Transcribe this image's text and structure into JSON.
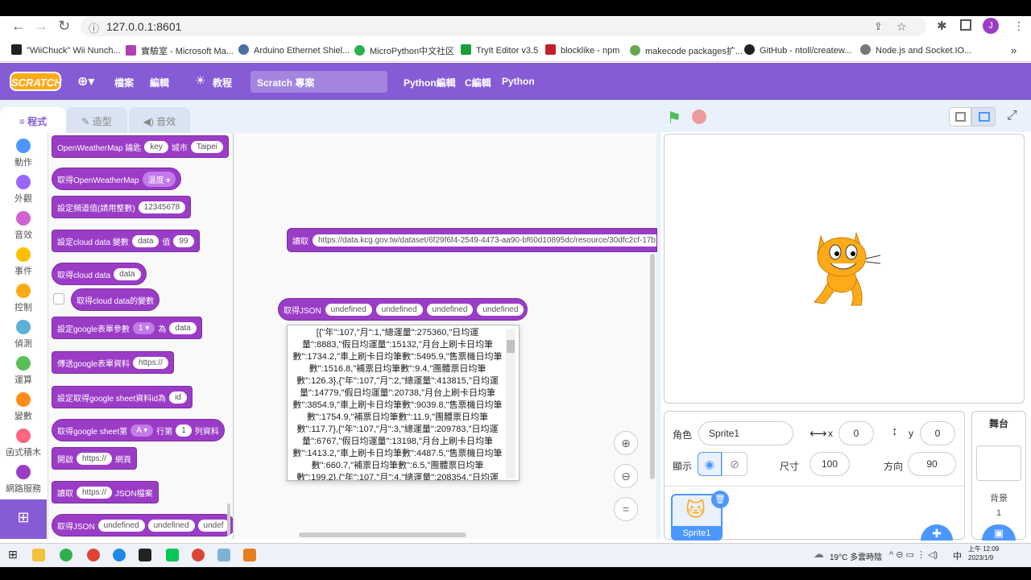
{
  "browser": {
    "url": "127.0.0.1:8601",
    "avatar": "J"
  },
  "bookmarks": [
    {
      "label": "\"WiiChuck\" Wii Nunch...",
      "color": "#222"
    },
    {
      "label": "實驗室 - Microsoft Ma...",
      "color": "#b03fb3"
    },
    {
      "label": "Arduino Ethernet Shiel...",
      "color": "#4a6fa5"
    },
    {
      "label": "MicroPython中文社区",
      "color": "#2bb24c"
    },
    {
      "label": "TryIt Editor v3.5",
      "color": "#1a9e3b"
    },
    {
      "label": "blocklike - npm",
      "color": "#c12127"
    },
    {
      "label": "makecode packages扩...",
      "color": "#6aa84f"
    },
    {
      "label": "GitHub - ntoll/createw...",
      "color": "#222"
    },
    {
      "label": "Node.js and Socket.IO...",
      "color": "#777"
    }
  ],
  "menubar": {
    "logo": "SCRATCH",
    "file": "檔案",
    "edit": "編輯",
    "tutorials": "教程",
    "project_title": "Scratch 專案",
    "python_editor": "Python編輯",
    "c_editor": "C編輯",
    "python": "Python"
  },
  "tabs": {
    "code": "程式",
    "costumes": "造型",
    "sounds": "音效"
  },
  "categories": [
    {
      "label": "動作",
      "color": "#4c97ff"
    },
    {
      "label": "外觀",
      "color": "#9966ff"
    },
    {
      "label": "音效",
      "color": "#cf63cf"
    },
    {
      "label": "事件",
      "color": "#ffbf00"
    },
    {
      "label": "控制",
      "color": "#ffab19"
    },
    {
      "label": "偵測",
      "color": "#5cb1d6"
    },
    {
      "label": "運算",
      "color": "#59c059"
    },
    {
      "label": "變數",
      "color": "#ff8c1a"
    },
    {
      "label": "函式積木",
      "color": "#ff6680"
    },
    {
      "label": "網路服務",
      "color": "#9b3cc7"
    }
  ],
  "palette": {
    "b1": {
      "text": "OpenWeatherMap 鑰匙",
      "p1": "key",
      "t2": "城市",
      "p2": "Taipei"
    },
    "b2": {
      "text": "取得OpenWeatherMap",
      "dd": "溫度"
    },
    "b3": {
      "text": "設定頻道值(請用整數)",
      "p1": "12345678"
    },
    "b4": {
      "text": "設定cloud data 變數",
      "p1": "data",
      "t2": "值",
      "p2": "99"
    },
    "b5": {
      "text": "取得cloud data",
      "p1": "data"
    },
    "b6": {
      "text": "取得cloud data的變數"
    },
    "b7": {
      "text": "設定google表單參數",
      "dd": "1",
      "t2": "為",
      "p2": "data"
    },
    "b8": {
      "text": "傳送google表單資料",
      "p1": "https://"
    },
    "b9": {
      "text": "設定取得google sheet資料id為",
      "p1": "id"
    },
    "b10": {
      "text": "取得google sheet第",
      "dd": "A",
      "t2": "行第",
      "p2": "1",
      "t3": "列資料"
    },
    "b11": {
      "text": "開啟",
      "p1": "https://",
      "t2": "網頁"
    },
    "b12": {
      "text": "讀取",
      "p1": "https://",
      "t2": "JSON檔案"
    },
    "b13": {
      "text": "取得JSON",
      "p1": "undefined",
      "p2": "undefined",
      "p3": "undef"
    }
  },
  "workspace": {
    "read_block": {
      "text": "讀取",
      "url": "https://data.kcg.gov.tw/dataset/6f29f6f4-2549-4473-aa90-bf60d10895dc/resource/30dfc2cf-17b"
    },
    "json_block": {
      "text": "取得JSON",
      "p1": "undefined",
      "p2": "undefined",
      "p3": "undefined",
      "p4": "undefined"
    },
    "popup_text": "[{\"年\":107,\"月\":1,\"總運量\":275360,\"日均運量\":8883,\"假日均運量\":15132,\"月台上刷卡日均筆數\":1734.2,\"車上刷卡日均筆數\":5495.9,\"售票機日均筆數\":1516.8,\"補票日均筆數\":9.4,\"團體票日均筆數\":126.3},{\"年\":107,\"月\":2,\"總運量\":413815,\"日均運量\":14779,\"假日均運量\":20738,\"月台上刷卡日均筆數\":3854.9,\"車上刷卡日均筆數\":9039.8,\"售票機日均筆數\":1754.9,\"補票日均筆數\":11.9,\"團體票日均筆數\":117.7},{\"年\":107,\"月\":3,\"總運量\":209783,\"日均運量\":6767,\"假日均運量\":13198,\"月台上刷卡日均筆數\":1413.2,\"車上刷卡日均筆數\":4487.5,\"售票機日均筆數\":660.7,\"補票日均筆數\":6.5,\"團體票日均筆數\":199.2},{\"年\":107,\"月\":4,\"總運量\":208354,\"日均運"
  },
  "sprite": {
    "label": "角色",
    "name": "Sprite1",
    "x_label": "x",
    "x": "0",
    "y_label": "y",
    "y": "0",
    "show_label": "顯示",
    "size_label": "尺寸",
    "size": "100",
    "dir_label": "方向",
    "dir": "90",
    "thumb_name": "Sprite1"
  },
  "stage_panel": {
    "title": "舞台",
    "backdrops_label": "背景",
    "backdrops": "1"
  },
  "taskbar": {
    "weather": "19°C 多雲時陰",
    "ime": "中",
    "time": "上午 12:09",
    "date": "2023/1/9"
  }
}
